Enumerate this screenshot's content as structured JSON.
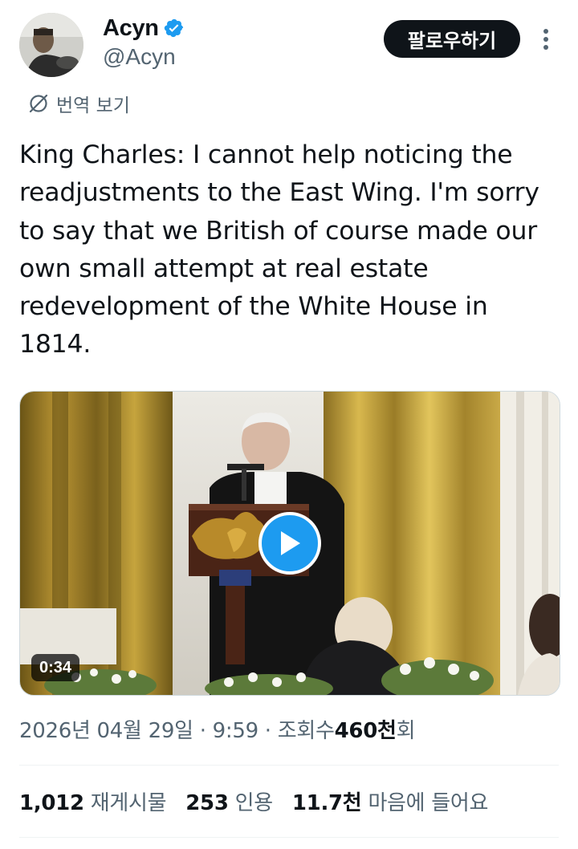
{
  "author": {
    "display_name": "Acyn",
    "handle": "@Acyn",
    "verified_icon": "verified-badge-icon",
    "verified_color": "#1d9bf0"
  },
  "follow_button_label": "팔로우하기",
  "translate_label": "번역 보기",
  "tweet_text": "King Charles: I cannot help noticing the readjustments to the East Wing. I'm sorry to say that we British of course made our own small attempt at real estate redevelopment of the White House in 1814.",
  "video": {
    "duration": "0:34",
    "play_icon": "play-icon",
    "accent_color": "#1d9bf0"
  },
  "meta": {
    "date": "2026년 04월 29일",
    "separator": "·",
    "time": "9:59",
    "views_label": "조회수",
    "views_count": "460천",
    "views_suffix": "회"
  },
  "stats": {
    "retweets_count": "1,012",
    "retweets_label": "재게시물",
    "quotes_count": "253",
    "quotes_label": "인용",
    "likes_count": "11.7천",
    "likes_label": "마음에 들어요"
  },
  "colors": {
    "text_primary": "#0f1419",
    "text_secondary": "#536471",
    "button_bg": "#0f1419"
  }
}
